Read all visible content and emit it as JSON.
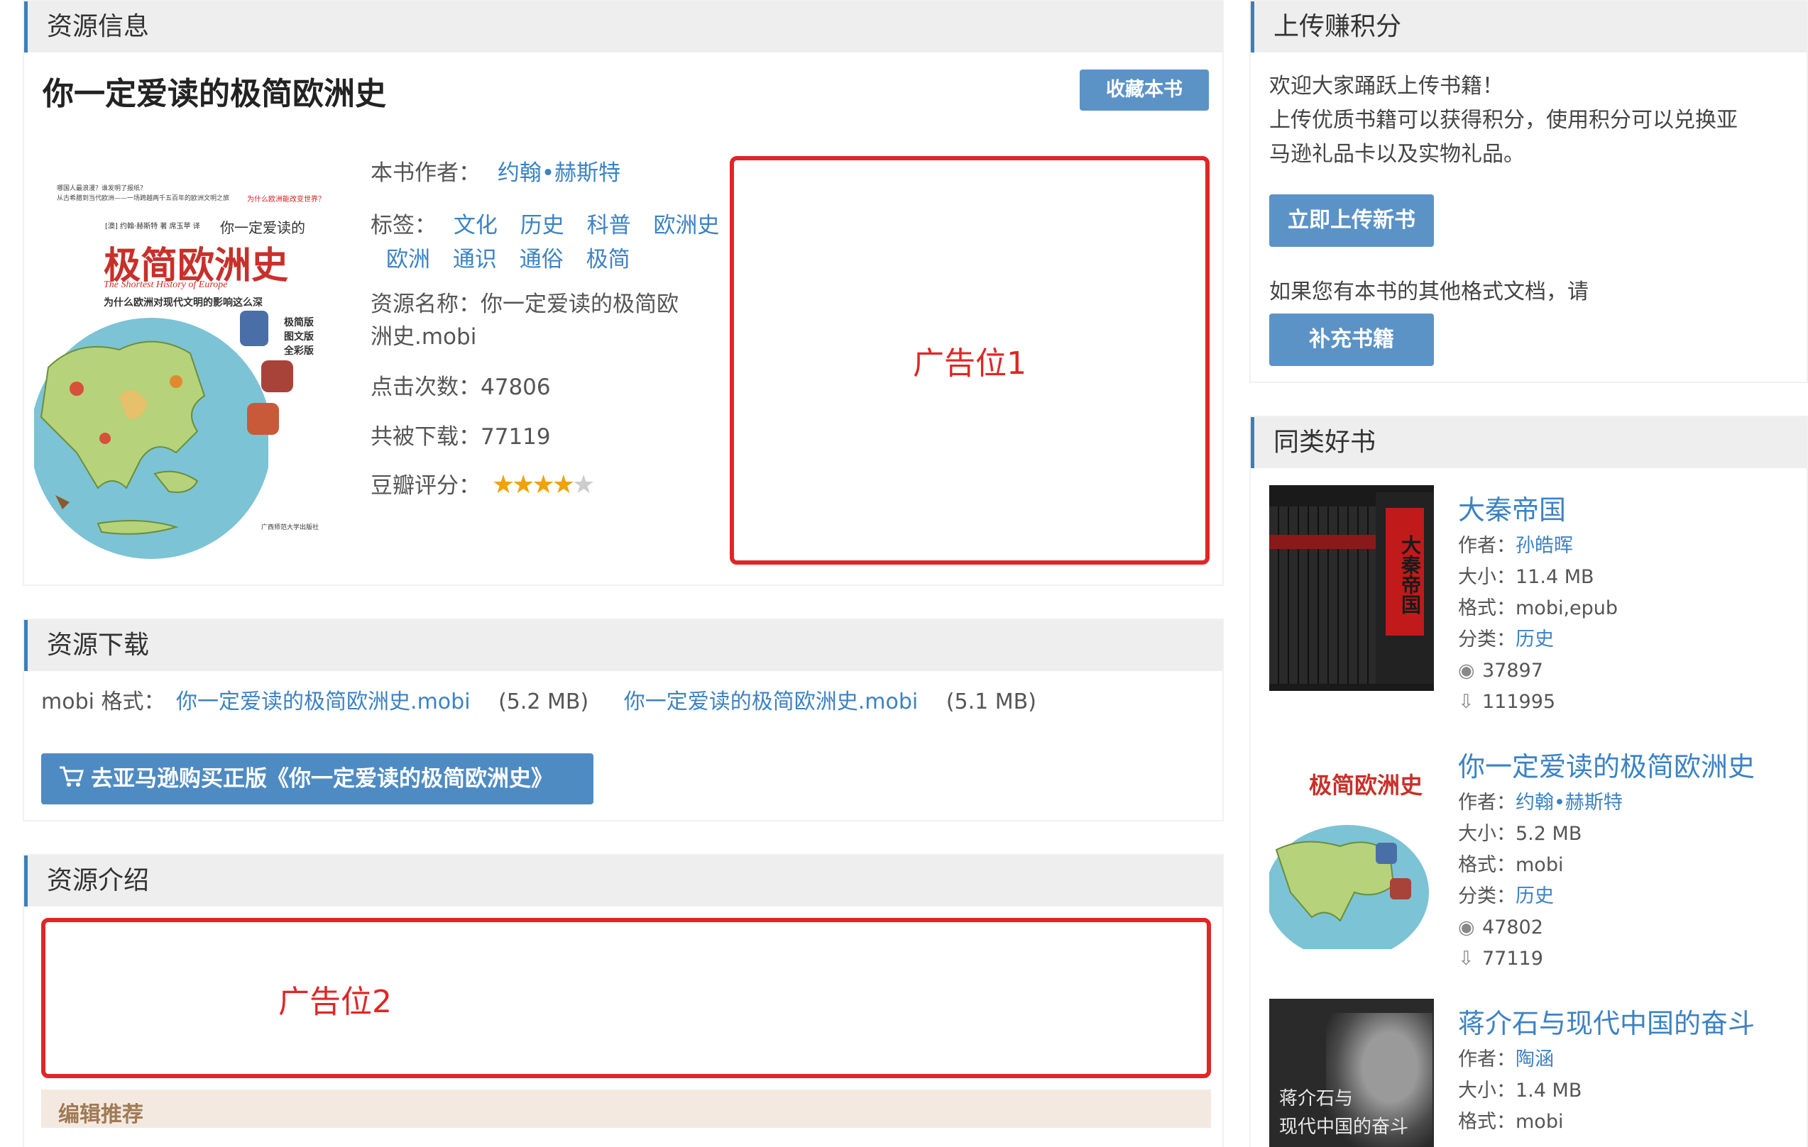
{
  "resource_info": {
    "header": "资源信息",
    "title": "你一定爱读的极简欧洲史",
    "collect_label": "收藏本书",
    "author_label": "本书作者：",
    "author": "约翰•赫斯特",
    "tags_label": "标签：",
    "tags": [
      "文化",
      "历史",
      "科普",
      "欧洲史",
      "欧洲",
      "通识",
      "通俗",
      "极简"
    ],
    "name_label": "资源名称：",
    "name_line1": "你一定爱读的极简欧",
    "name_line2": "洲史.mobi",
    "clicks_label": "点击次数：",
    "clicks": "47806",
    "downloads_label": "共被下载：",
    "downloads": "77119",
    "rating_label": "豆瓣评分：",
    "rating_stars": 4,
    "rating_max": 5,
    "ad1": "广告位1",
    "cover": {
      "top_small_1": "哪国人最浪漫？谁发明了报纸？",
      "top_small_2": "从古希腊到当代欧洲——一场跨越两千五百年的欧洲文明之旅",
      "top_red": "为什么欧洲能改变世界？",
      "authors": "[澳] 约翰·赫斯特 著  席玉苹 译",
      "subtitle_small": "你一定爱读的",
      "main_title": "极简欧洲史",
      "english": "The Shortest History of Europe",
      "tagline": "为什么欧洲对现代文明的影响这么深",
      "side_notes": [
        "极简版",
        "图文版",
        "全彩版"
      ],
      "publisher": "广西师范大学出版社"
    }
  },
  "download": {
    "header": "资源下载",
    "format_label": "mobi 格式：",
    "files": [
      {
        "name": "你一定爱读的极简欧洲史.mobi",
        "size": "(5.2 MB)"
      },
      {
        "name": "你一定爱读的极简欧洲史.mobi",
        "size": "(5.1 MB)"
      }
    ],
    "buy_label": "去亚马逊购买正版《你一定爱读的极简欧洲史》"
  },
  "intro": {
    "header": "资源介绍",
    "ad2": "广告位2",
    "editor_pick": "编辑推荐"
  },
  "upload": {
    "header": "上传赚积分",
    "line1": "欢迎大家踊跃上传书籍！",
    "line2": "上传优质书籍可以获得积分，使用积分可以兑换亚",
    "line3": "马逊礼品卡以及实物礼品。",
    "upload_btn": "立即上传新书",
    "other_format": "如果您有本书的其他格式文档，请",
    "supplement_btn": "补充书籍"
  },
  "similar": {
    "header": "同类好书",
    "author_label": "作者：",
    "size_label": "大小：",
    "format_label": "格式：",
    "category_label": "分类：",
    "books": [
      {
        "title": "大秦帝国",
        "author": "孙皓晖",
        "size": "11.4 MB",
        "format": "mobi,epub",
        "category": "历史",
        "views": "37897",
        "downloads": "111995",
        "cover_text": "大秦帝国"
      },
      {
        "title": "你一定爱读的极简欧洲史",
        "author": "约翰•赫斯特",
        "size": "5.2 MB",
        "format": "mobi",
        "category": "历史",
        "views": "47802",
        "downloads": "77119",
        "cover_text": "极简欧洲史"
      },
      {
        "title": "蒋介石与现代中国的奋斗",
        "author": "陶涵",
        "size": "1.4 MB",
        "format": "mobi",
        "cover_text_1": "蒋介石与",
        "cover_text_2": "现代中国的奋斗"
      }
    ]
  },
  "colors": {
    "accent": "#3c82c4",
    "button": "#5b93c7",
    "ad_border": "#e02626",
    "star": "#f0a20a",
    "star_off": "#cccccc"
  }
}
